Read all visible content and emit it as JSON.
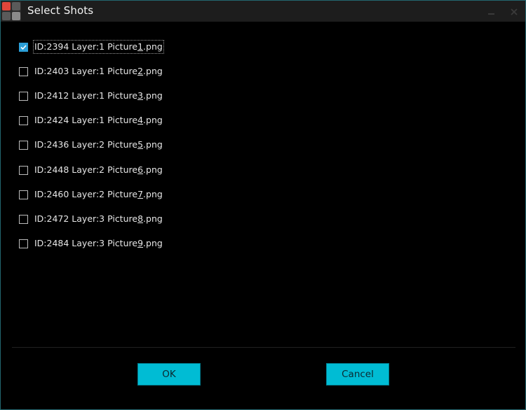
{
  "window": {
    "title": "Select Shots"
  },
  "shots": [
    {
      "pre": "ID:2394 Layer:1 Picture",
      "num": "1",
      "post": ".png",
      "checked": true,
      "focused": true
    },
    {
      "pre": "ID:2403 Layer:1 Picture",
      "num": "2",
      "post": ".png",
      "checked": false,
      "focused": false
    },
    {
      "pre": "ID:2412 Layer:1 Picture",
      "num": "3",
      "post": ".png",
      "checked": false,
      "focused": false
    },
    {
      "pre": "ID:2424 Layer:1 Picture",
      "num": "4",
      "post": ".png",
      "checked": false,
      "focused": false
    },
    {
      "pre": "ID:2436 Layer:2 Picture",
      "num": "5",
      "post": ".png",
      "checked": false,
      "focused": false
    },
    {
      "pre": "ID:2448 Layer:2 Picture",
      "num": "6",
      "post": ".png",
      "checked": false,
      "focused": false
    },
    {
      "pre": "ID:2460 Layer:2 Picture",
      "num": "7",
      "post": ".png",
      "checked": false,
      "focused": false
    },
    {
      "pre": "ID:2472 Layer:3 Picture",
      "num": "8",
      "post": ".png",
      "checked": false,
      "focused": false
    },
    {
      "pre": "ID:2484 Layer:3 Picture",
      "num": "9",
      "post": ".png",
      "checked": false,
      "focused": false
    }
  ],
  "buttons": {
    "ok_label": "OK",
    "cancel_label": "Cancel"
  },
  "colors": {
    "accent": "#00bcd4",
    "checkbox_check": "#2b9fd8",
    "window_border": "#23666f",
    "titlebar": "#1d1d1d"
  },
  "icons": {
    "app": "app-logo-icon",
    "minimize": "minimize-icon",
    "close": "close-icon",
    "check": "checkmark-icon"
  }
}
